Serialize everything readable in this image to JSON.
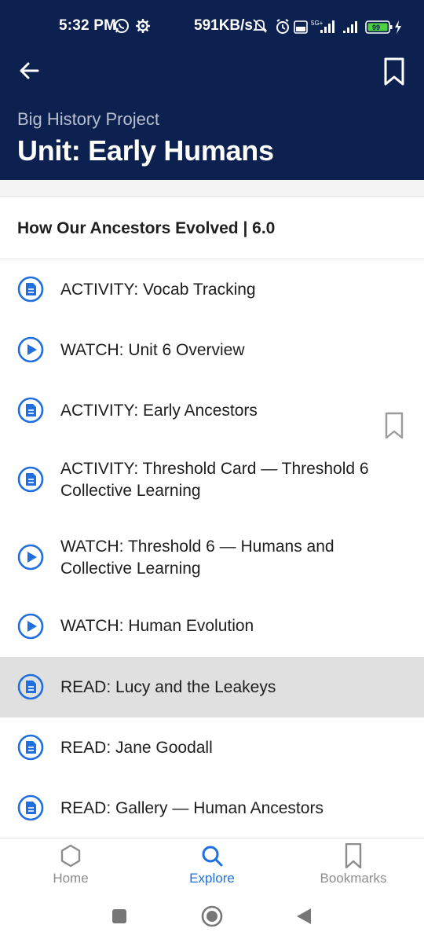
{
  "status_bar": {
    "time": "5:32 PM",
    "speed": "591KB/s",
    "network": "5G+",
    "battery": "99"
  },
  "header": {
    "subtitle": "Big History Project",
    "title": "Unit: Early Humans",
    "color": "#0d2150"
  },
  "section": {
    "title": "How Our Ancestors Evolved | 6.0"
  },
  "items": [
    {
      "label": "ACTIVITY: Vocab Tracking",
      "icon": "document-icon"
    },
    {
      "label": "WATCH: Unit 6 Overview",
      "icon": "play-icon"
    },
    {
      "label": "ACTIVITY: Early Ancestors",
      "icon": "document-icon"
    },
    {
      "label": "ACTIVITY: Threshold Card — Threshold 6 Collective Learning",
      "icon": "document-icon"
    },
    {
      "label": "WATCH: Threshold 6 — Humans and Collective Learning",
      "icon": "play-icon"
    },
    {
      "label": "WATCH: Human Evolution",
      "icon": "play-icon"
    },
    {
      "label": "READ: Lucy and the Leakeys",
      "icon": "document-icon",
      "selected": true
    },
    {
      "label": "READ: Jane Goodall",
      "icon": "document-icon"
    },
    {
      "label": "READ: Gallery — Human Ancestors",
      "icon": "document-icon"
    }
  ],
  "nav": {
    "home": "Home",
    "explore": "Explore",
    "bookmarks": "Bookmarks",
    "active": "explore",
    "accent": "#1f6fe0"
  }
}
